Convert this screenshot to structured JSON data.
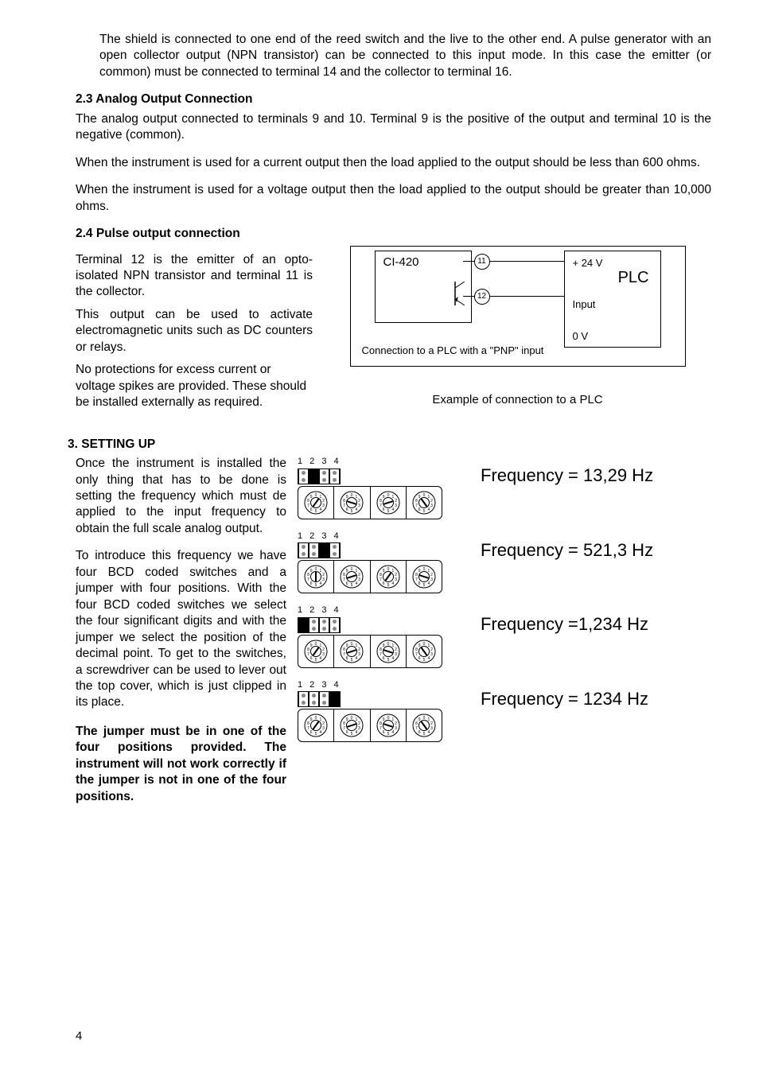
{
  "intro_para": "The shield is connected to one end of the reed switch and the live to the other end. A pulse generator with an open collector output (NPN transistor) can be connected to this input mode. In this case the emitter (or common) must be connected to terminal 14 and the collector to terminal 16.",
  "sec23_title": "2.3 Analog Output Connection",
  "sec23_p1": "The analog output connected to terminals 9 and 10. Terminal 9 is the positive of the output and terminal 10 is the negative (common).",
  "sec23_p2": "When the instrument is used for a current output then the load applied to the output should be less than 600 ohms.",
  "sec23_p3": "When the instrument is used for a voltage output then the load applied to the output should be greater than 10,000 ohms.",
  "sec24_title": "2.4 Pulse output connection",
  "sec24_p1": "Terminal 12 is the emitter of an opto-isolated NPN transistor and terminal 11 is the collector.",
  "sec24_p2": "This output can be used to activate electromagnetic units such as DC counters or relays.",
  "sec24_p3": "No protections for excess current or voltage spikes are provided. These should be installed externally as required.",
  "diagram": {
    "ci420": "CI-420",
    "plc": "PLC",
    "v24": "+ 24 V",
    "input": "Input",
    "v0": "0 V",
    "term11": "11",
    "term12": "12",
    "caption": "Connection to a PLC with a \"PNP\" input",
    "example": "Example of connection to a PLC"
  },
  "sec3_title": "3. SETTING UP",
  "sec3_p1": "Once the instrument is installed the only thing that has to be done is setting the frequency which must de applied to the input frequency to obtain the full scale analog output.",
  "sec3_p2": "To introduce this frequency we have four BCD coded switches and a jumper with four positions. With the four BCD coded switches we select the four significant digits and with the jumper we select the position of the decimal point. To get to the switches, a screwdriver can be used to lever out the top cover, which is just clipped in its place.",
  "sec3_p3": "The jumper must be in one of the four positions provided. The instrument will not work correctly if the jumper is not in one of the four positions.",
  "dip_label": "1 2 3 4",
  "freq": [
    {
      "text": "Frequency = 13,29  Hz",
      "selected": 2,
      "encoders": [
        1,
        3,
        2,
        9
      ]
    },
    {
      "text": "Frequency = 521,3  Hz",
      "selected": 3,
      "encoders": [
        5,
        2,
        1,
        3
      ]
    },
    {
      "text": "Frequency =1,234  Hz",
      "selected": 1,
      "encoders": [
        1,
        2,
        3,
        4
      ]
    },
    {
      "text": "Frequency = 1234  Hz",
      "selected": 4,
      "encoders": [
        1,
        2,
        3,
        4
      ]
    }
  ],
  "page_number": "4"
}
